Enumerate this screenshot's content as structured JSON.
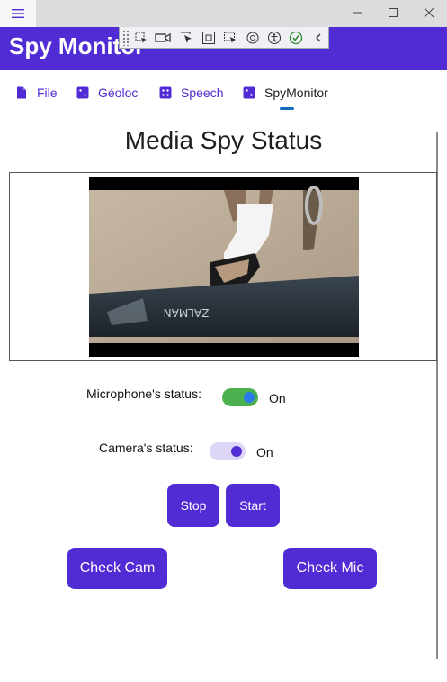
{
  "window": {
    "app_title": "Spy Monitor",
    "icons": [
      "hamburger-icon",
      "minimize-icon",
      "maximize-icon",
      "close-icon"
    ]
  },
  "menu": {
    "items": [
      {
        "label": "File"
      },
      {
        "label": "Géoloc"
      },
      {
        "label": "Speech"
      },
      {
        "label": "SpyMonitor",
        "selected": true
      }
    ]
  },
  "page": {
    "title": "Media Spy Status"
  },
  "microphone": {
    "label": "Microphone's status:",
    "state": "On",
    "on": true,
    "toggle_color": "#4caf50"
  },
  "camera": {
    "label": "Camera's status:",
    "state": "On",
    "on": true,
    "toggle_color": "#ddd6f7"
  },
  "buttons": {
    "stop": "Stop",
    "start": "Start",
    "check_cam": "Check Cam",
    "check_mic": "Check Mic"
  },
  "colors": {
    "accent": "#512bd4",
    "titlebar": "#dcdcdc"
  }
}
